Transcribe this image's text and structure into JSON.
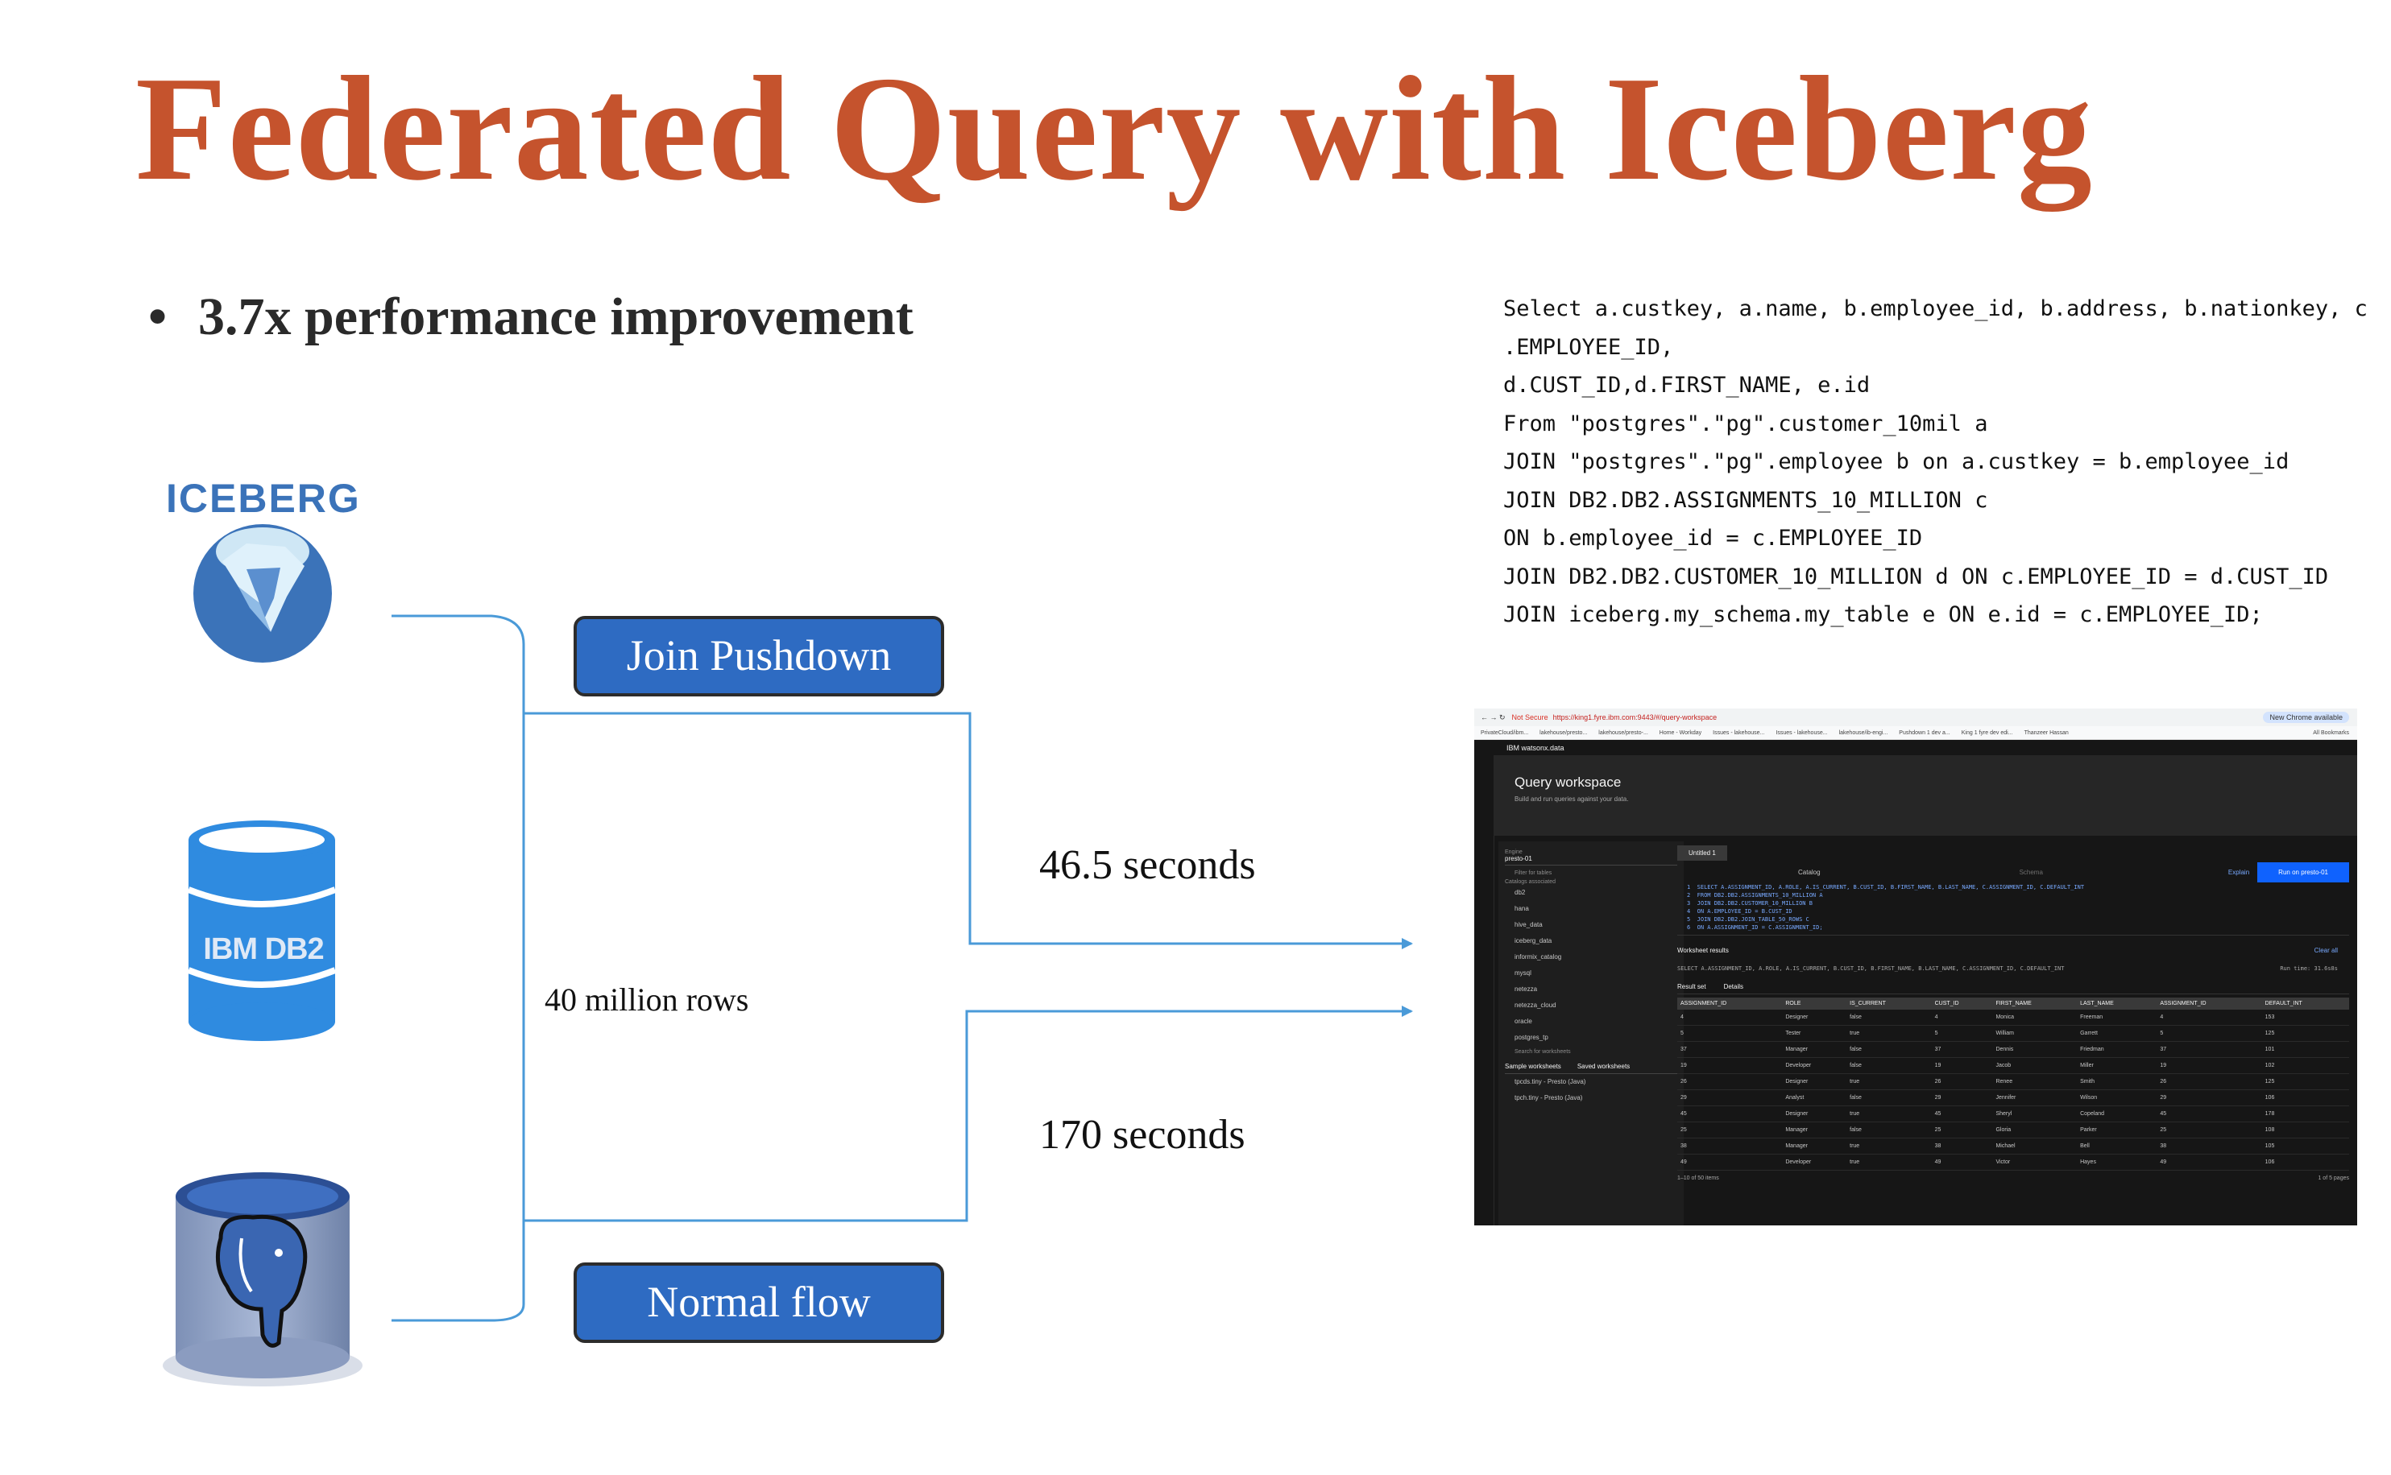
{
  "slide": {
    "title": "Federated Query with Iceberg",
    "bullet": "3.7x performance improvement",
    "bullet_marker": "•"
  },
  "sql": [
    "Select a.custkey, a.name, b.employee_id, b.address, b.nationkey, c",
    ".EMPLOYEE_ID,",
    "d.CUST_ID,d.FIRST_NAME, e.id",
    "From \"postgres\".\"pg\".customer_10mil a",
    "JOIN \"postgres\".\"pg\".employee b on a.custkey = b.employee_id",
    "JOIN DB2.DB2.ASSIGNMENTS_10_MILLION c",
    "ON b.employee_id = c.EMPLOYEE_ID",
    "JOIN DB2.DB2.CUSTOMER_10_MILLION d ON c.EMPLOYEE_ID = d.CUST_ID",
    "JOIN iceberg.my_schema.my_table e ON e.id = c.EMPLOYEE_ID;"
  ],
  "diagram": {
    "iceberg_label": "ICEBERG",
    "db2_label": "IBM DB2",
    "join_pushdown": "Join Pushdown",
    "normal_flow": "Normal flow",
    "rows_label": "40 million rows",
    "fast_time": "46.5 seconds",
    "slow_time": "170 seconds"
  },
  "colors": {
    "title": "#c5532d",
    "pill": "#2e6bc2",
    "connector": "#4a9ad8"
  },
  "screenshot": {
    "url_warning": "Not Secure",
    "url": "https://king1.fyre.ibm.com:9443/#/query-workspace",
    "new_chrome": "New Chrome available",
    "all_bookmarks": "All Bookmarks",
    "bookmarks": [
      "PrivateCloud/ibm...",
      "lakehouse/presto...",
      "lakehouse/presto-...",
      "Home - Workday",
      "Issues - lakehouse...",
      "Issues - lakehouse...",
      "lakehouse/ib-engi...",
      "Pushdown 1 dev a...",
      "King 1 fyre dev edi...",
      "Thanzeer Hassan"
    ],
    "product": "IBM watsonx.data",
    "page_title": "Query workspace",
    "page_sub": "Build and run queries against your data.",
    "engine_label": "Engine",
    "engine_value": "presto-01",
    "filter_placeholder": "Filter for tables",
    "catalog_label": "Catalogs associated",
    "catalogs": [
      "db2",
      "hana",
      "hive_data",
      "iceberg_data",
      "informix_catalog",
      "mysql",
      "netezza",
      "netezza_cloud",
      "oracle",
      "postgres_tp"
    ],
    "search_worksheets": "Search for worksheets",
    "ws_tabs": [
      "Sample worksheets",
      "Saved worksheets"
    ],
    "worksheets": [
      "tpcds.tiny - Presto (Java)",
      "tpch.tiny - Presto (Java)"
    ],
    "tab_name": "Untitled 1",
    "catalog_select": "Catalog",
    "schema_select": "Schema",
    "explain": "Explain",
    "run_button": "Run on presto-01",
    "editor_lines": [
      "1  SELECT A.ASSIGNMENT_ID, A.ROLE, A.IS_CURRENT, B.CUST_ID, B.FIRST_NAME, B.LAST_NAME, C.ASSIGNMENT_ID, C.DEFAULT_INT",
      "2  FROM DB2.DB2.ASSIGNMENTS_10_MILLION A",
      "3  JOIN DB2.DB2.CUSTOMER_10_MILLION B",
      "4  ON A.EMPLOYEE_ID = B.CUST_ID",
      "5  JOIN DB2.DB2.JOIN_TABLE_50_ROWS C",
      "6  ON A.ASSIGNMENT_ID = C.ASSIGNMENT_ID;"
    ],
    "results_title": "Worksheet results",
    "clear_all": "Clear all",
    "result_query": "SELECT A.ASSIGNMENT_ID, A.ROLE, A.IS_CURRENT, B.CUST_ID, B.FIRST_NAME, B.LAST_NAME, C.ASSIGNMENT_ID, C.DEFAULT_INT",
    "run_time": "Run time: 31.6s8s",
    "result_tabs": [
      "Result set",
      "Details"
    ],
    "columns": [
      "ASSIGNMENT_ID",
      "ROLE",
      "IS_CURRENT",
      "CUST_ID",
      "FIRST_NAME",
      "LAST_NAME",
      "ASSIGNMENT_ID",
      "DEFAULT_INT"
    ],
    "rows": [
      [
        "4",
        "Designer",
        "false",
        "4",
        "Monica",
        "Freeman",
        "4",
        "153"
      ],
      [
        "5",
        "Tester",
        "true",
        "5",
        "William",
        "Garrett",
        "5",
        "125"
      ],
      [
        "37",
        "Manager",
        "false",
        "37",
        "Dennis",
        "Friedman",
        "37",
        "101"
      ],
      [
        "19",
        "Developer",
        "false",
        "19",
        "Jacob",
        "Miller",
        "19",
        "102"
      ],
      [
        "26",
        "Designer",
        "true",
        "26",
        "Renee",
        "Smith",
        "26",
        "125"
      ],
      [
        "29",
        "Analyst",
        "false",
        "29",
        "Jennifer",
        "Wilson",
        "29",
        "106"
      ],
      [
        "45",
        "Designer",
        "true",
        "45",
        "Sheryl",
        "Copeland",
        "45",
        "178"
      ],
      [
        "25",
        "Manager",
        "false",
        "25",
        "Gloria",
        "Parker",
        "25",
        "108"
      ],
      [
        "38",
        "Manager",
        "true",
        "38",
        "Michael",
        "Bell",
        "38",
        "105"
      ],
      [
        "49",
        "Developer",
        "true",
        "49",
        "Victor",
        "Hayes",
        "49",
        "106"
      ]
    ],
    "items_text": "1–10 of 50 items",
    "pages_text": "of 5 pages",
    "page_value": "1"
  }
}
